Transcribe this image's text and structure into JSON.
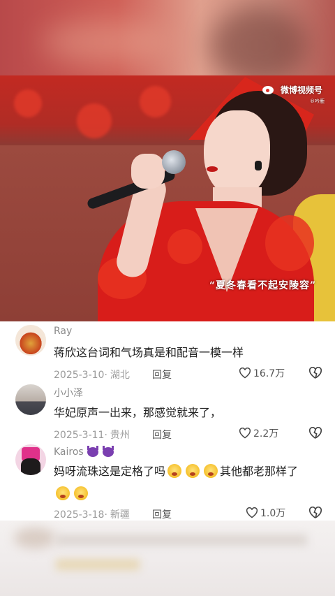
{
  "video": {
    "watermark": "微博视频号",
    "watermark_sub": "®吟鹿",
    "subtitle": "“夏冬春看不起安陵容”"
  },
  "comments": [
    {
      "username": "Ray",
      "text": "蒋欣这台词和气场真是和配音一模一样",
      "date": "2025-3-10",
      "location": "湖北",
      "reply_label": "回复",
      "likes": "16.7万"
    },
    {
      "username": "小小泽",
      "text": "华妃原声一出来，那感觉就来了，",
      "date": "2025-3-11",
      "location": "贵州",
      "reply_label": "回复",
      "likes": "2.2万"
    },
    {
      "username": "Kairos",
      "text_line1": "妈呀流珠这是定格了吗",
      "text_line1_end": "其他都老那样了",
      "date": "2025-3-18",
      "location": "新疆",
      "reply_label": "回复",
      "likes": "1.0万"
    }
  ]
}
